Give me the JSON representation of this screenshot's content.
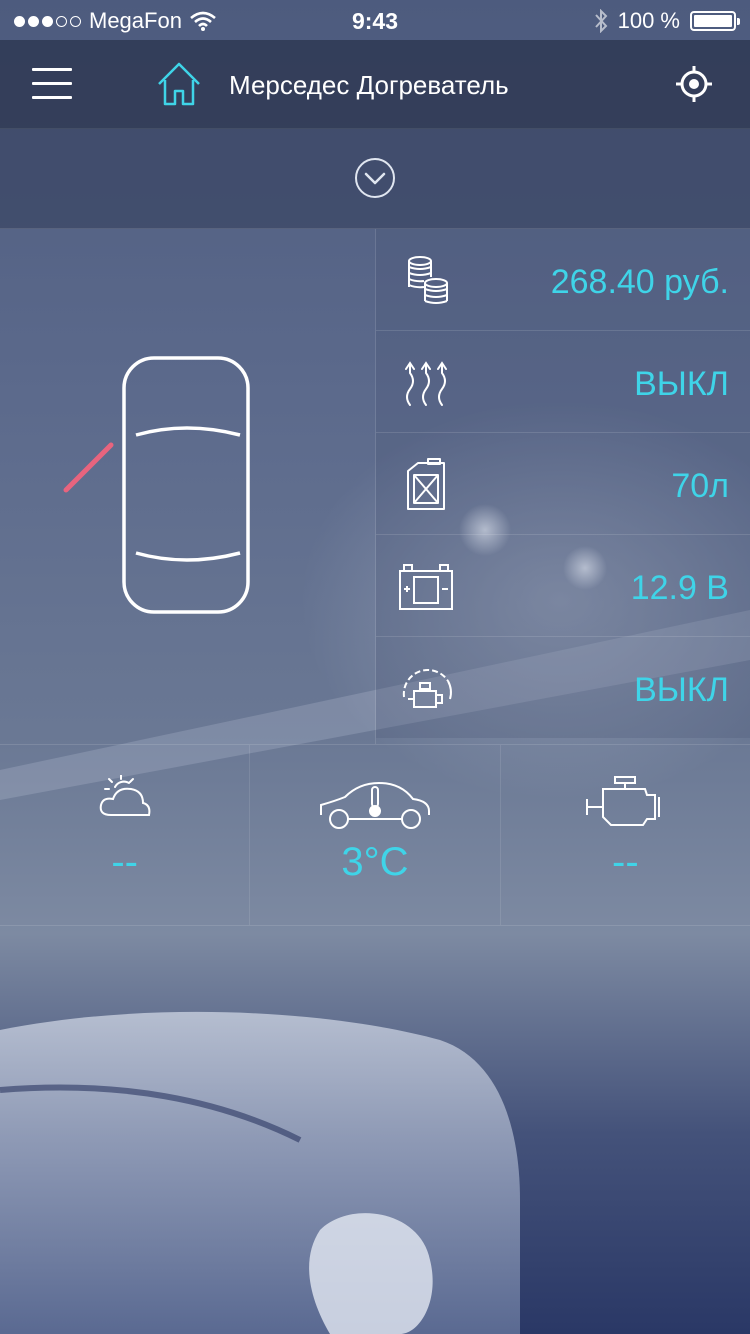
{
  "status_bar": {
    "carrier": "MegaFon",
    "time": "9:43",
    "battery_percent": "100 %"
  },
  "nav": {
    "title": "Мерседес Догреватель"
  },
  "stats": [
    {
      "icon": "coins-icon",
      "value": "268.40 руб."
    },
    {
      "icon": "heat-icon",
      "value": "ВЫКЛ"
    },
    {
      "icon": "fuel-can-icon",
      "value": "70л"
    },
    {
      "icon": "battery-icon",
      "value": "12.9 В"
    },
    {
      "icon": "engine-start-icon",
      "value": "ВЫКЛ"
    }
  ],
  "temperatures": [
    {
      "icon": "weather-icon",
      "value": "--"
    },
    {
      "icon": "car-interior-temp-icon",
      "value": "3°C"
    },
    {
      "icon": "engine-temp-icon",
      "value": "--"
    }
  ],
  "colors": {
    "accent": "#3fd4e8",
    "door_open": "#e8647e"
  }
}
